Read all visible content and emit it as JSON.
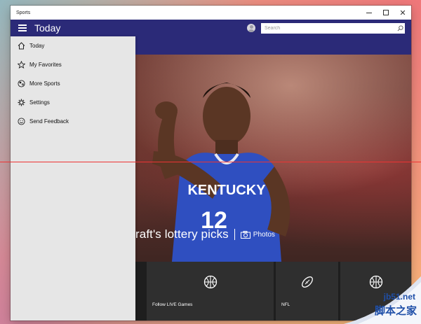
{
  "window": {
    "title": "Sports"
  },
  "appbar": {
    "title": "Today",
    "search_placeholder": "Search"
  },
  "nav": {
    "items": [
      {
        "label": "Today",
        "icon": "home-icon"
      },
      {
        "label": "My Favorites",
        "icon": "star-icon"
      },
      {
        "label": "More Sports",
        "icon": "ball-icon"
      },
      {
        "label": "Settings",
        "icon": "gear-icon"
      },
      {
        "label": "Send Feedback",
        "icon": "smiley-icon"
      }
    ]
  },
  "hero": {
    "headline": "raft's lottery picks",
    "photos_label": "Photos",
    "jersey_text": "KENTUCKY",
    "jersey_number": "12"
  },
  "tiles": [
    {
      "label": "Follow LIVE Games",
      "icon": "basketball-icon"
    },
    {
      "label": "NFL",
      "icon": "football-icon"
    },
    {
      "label": "",
      "icon": "basketball-icon"
    }
  ],
  "watermark": {
    "line1": "jb51.net",
    "line2": "脚本之家"
  },
  "colors": {
    "accent": "#2b2a78",
    "drawer": "#e6e6e6",
    "tile": "#2f2f2f"
  }
}
